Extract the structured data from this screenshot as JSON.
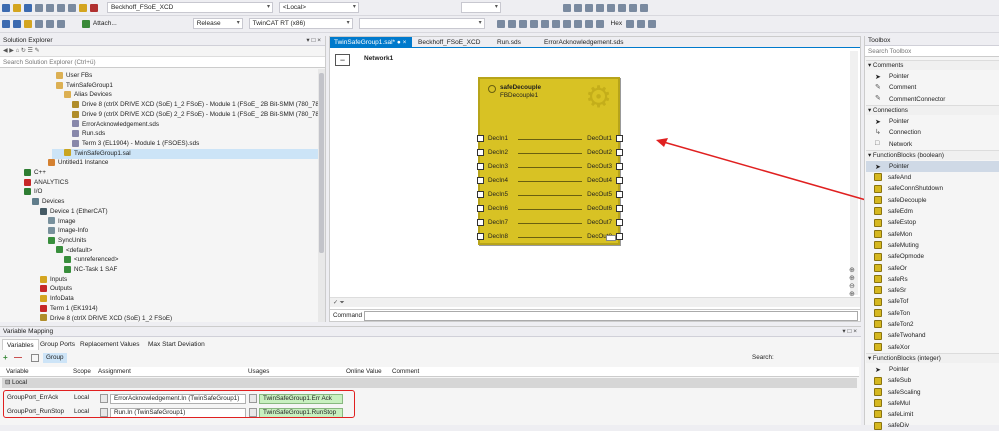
{
  "toolbar1": {
    "combo_project": "Beckhoff_FSoE_XCD",
    "combo_local": "<Local>"
  },
  "toolbar2": {
    "attach_label": "Attach...",
    "config_combo": "Release",
    "platform_combo": "TwinCAT RT (x86)",
    "hex_label": "Hex"
  },
  "solution_explorer": {
    "title": "Solution Explorer",
    "search_placeholder": "Search Solution Explorer (Ctrl+ü)",
    "items": [
      {
        "label": "User FBs",
        "icon": "folder-icon"
      },
      {
        "label": "TwinSafeGroup1",
        "icon": "folder-icon"
      },
      {
        "label": "Alias Devices",
        "icon": "folder-icon"
      },
      {
        "label": "Drive 8 (ctrlX DRIVE XCD (SoE) 1_2 FSoE) - Module 1 (FSoE_ 2B Bit-SMM (780_784))",
        "icon": "drive-icon"
      },
      {
        "label": "Drive 9 (ctrlX DRIVE XCD (SoE) 2_2 FSoE) - Module 1 (FSoE_ 2B Bit-SMM (780_784))",
        "icon": "drive-icon"
      },
      {
        "label": "ErrorAcknowledgement.sds",
        "icon": "file-icon"
      },
      {
        "label": "Run.sds",
        "icon": "file-icon"
      },
      {
        "label": "Term 3 (EL1904) - Module 1 (FSOES).sds",
        "icon": "file-icon"
      },
      {
        "label": "TwinSafeGroup1.sal",
        "icon": "sal-icon"
      },
      {
        "label": "Untitled1 Instance",
        "icon": "instance-icon"
      },
      {
        "label": "C++",
        "icon": "cpp-icon"
      },
      {
        "label": "ANALYTICS",
        "icon": "analytics-icon"
      },
      {
        "label": "I/O",
        "icon": "io-icon"
      },
      {
        "label": "Devices",
        "icon": "devices-icon"
      },
      {
        "label": "Device 1 (EtherCAT)",
        "icon": "ethercat-icon"
      },
      {
        "label": "Image",
        "icon": "image-icon"
      },
      {
        "label": "Image-Info",
        "icon": "image-icon"
      },
      {
        "label": "SyncUnits",
        "icon": "sync-icon"
      },
      {
        "label": "<default>",
        "icon": "sync-icon"
      },
      {
        "label": "<unreferenced>",
        "icon": "sync-icon"
      },
      {
        "label": "NC-Task 1 SAF",
        "icon": "sync-icon"
      },
      {
        "label": "Inputs",
        "icon": "inputs-icon"
      },
      {
        "label": "Outputs",
        "icon": "outputs-icon"
      },
      {
        "label": "InfoData",
        "icon": "infodata-icon"
      },
      {
        "label": "Term 1 (EK1914)",
        "icon": "term-icon"
      },
      {
        "label": "Drive 8 (ctrlX DRIVE XCD (SoE) 1_2 FSoE)",
        "icon": "drive-icon"
      }
    ]
  },
  "editor": {
    "tabs": [
      "TwinSafeGroup1.sal*",
      "Beckhoff_FSoE_XCD",
      "Run.sds",
      "ErrorAcknowledgement.sds"
    ],
    "network_label": "Network1",
    "collapse_symbol": "−",
    "fb": {
      "type": "safeDecouple",
      "instance": "FBDecouple1",
      "inputs": [
        "DecIn1",
        "DecIn2",
        "DecIn3",
        "DecIn4",
        "DecIn5",
        "DecIn6",
        "DecIn7",
        "DecIn8"
      ],
      "outputs": [
        "DecOut1",
        "DecOut2",
        "DecOut3",
        "DecOut4",
        "DecOut5",
        "DecOut6",
        "DecOut7",
        "DecOut8"
      ]
    },
    "command_label": "Command"
  },
  "toolbox": {
    "title": "Toolbox",
    "search_placeholder": "Search Toolbox",
    "sections": [
      {
        "label": "Comments",
        "items": [
          "Pointer",
          "Comment",
          "CommentConnector"
        ]
      },
      {
        "label": "Connections",
        "items": [
          "Pointer",
          "Connection",
          "Network"
        ]
      },
      {
        "label": "FunctionBlocks (boolean)",
        "items": [
          "Pointer",
          "safeAnd",
          "safeConnShutdown",
          "safeDecouple",
          "safeEdm",
          "safeEstop",
          "safeMon",
          "safeMuting",
          "safeOpmode",
          "safeOr",
          "safeRs",
          "safeSr",
          "safeTof",
          "safeTon",
          "safeTon2",
          "safeTwohand",
          "safeXor"
        ]
      },
      {
        "label": "FunctionBlocks (integer)",
        "items": [
          "Pointer",
          "safeSub",
          "safeScaling",
          "safeMul",
          "safeLimit",
          "safeDiv"
        ]
      }
    ]
  },
  "variable_mapping": {
    "title": "Variable Mapping",
    "tabs": [
      "Variables",
      "Group Ports",
      "Replacement Values",
      "Max Start Deviation"
    ],
    "group_label": "Group",
    "search_label": "Search:",
    "columns": [
      "Variable",
      "Scope",
      "Assignment",
      "Usages",
      "Online Value",
      "Comment"
    ],
    "group_header": "Local",
    "rows": [
      {
        "variable": "GroupPort_ErrAck",
        "scope": "Local",
        "assignment": "ErrorAcknowledgement.In (TwinSafeGroup1)",
        "usage": "TwinSafeGroup1.Err Ack"
      },
      {
        "variable": "GroupPort_RunStop",
        "scope": "Local",
        "assignment": "Run.In (TwinSafeGroup1)",
        "usage": "TwinSafeGroup1.RunStop"
      }
    ]
  },
  "colors": {
    "accent": "#007acc",
    "fb_yellow": "#d8c224",
    "annotation_red": "#e02020",
    "usage_green": "#c8f0c0"
  }
}
